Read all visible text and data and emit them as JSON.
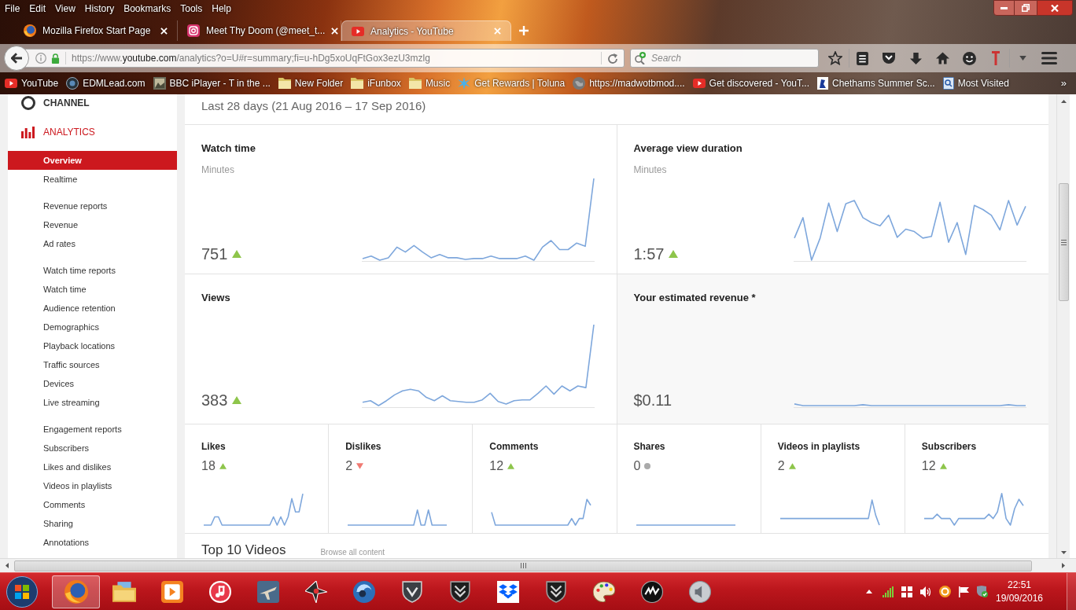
{
  "menu_bar": [
    "File",
    "Edit",
    "View",
    "History",
    "Bookmarks",
    "Tools",
    "Help"
  ],
  "tabs": [
    {
      "title": "Mozilla Firefox Start Page",
      "kind": "browser",
      "selected": false
    },
    {
      "title": "Meet Thy Doom (@meet_t...",
      "kind": "camera",
      "selected": false
    },
    {
      "title": "Analytics - YouTube",
      "kind": "video",
      "selected": true
    }
  ],
  "address_bar": {
    "url_prefix": "https://www.",
    "url_domain": "youtube.com",
    "url_path": "/analytics?o=U#r=summary;fi=u-hDg5xoUqFtGox3ezU3mzlg"
  },
  "search": {
    "placeholder": "Search"
  },
  "bookmarks": [
    {
      "label": "YouTube",
      "kind": "video"
    },
    {
      "label": "EDMLead.com",
      "kind": "orb"
    },
    {
      "label": "BBC iPlayer - T in the ...",
      "kind": "picture"
    },
    {
      "label": "New Folder",
      "kind": "folder"
    },
    {
      "label": "iFunbox",
      "kind": "folder"
    },
    {
      "label": "Music",
      "kind": "folder"
    },
    {
      "label": "Get Rewards | Toluna",
      "kind": "burst"
    },
    {
      "label": "https://madwotbmod....",
      "kind": "globe"
    },
    {
      "label": "Get discovered - YouT...",
      "kind": "video"
    },
    {
      "label": "Chethams Summer Sc...",
      "kind": "figure"
    },
    {
      "label": "Most Visited",
      "kind": "page"
    }
  ],
  "bookmarks_overflow": "»",
  "sidebar": {
    "channel": "CHANNEL",
    "section": "ANALYTICS",
    "groups": [
      {
        "items": [
          {
            "label": "Overview",
            "selected": true
          },
          {
            "label": "Realtime",
            "selected": false
          }
        ]
      },
      {
        "items": [
          {
            "label": "Revenue reports",
            "selected": false
          },
          {
            "label": "Revenue",
            "selected": false
          },
          {
            "label": "Ad rates",
            "selected": false
          }
        ]
      },
      {
        "items": [
          {
            "label": "Watch time reports",
            "selected": false
          },
          {
            "label": "Watch time",
            "selected": false
          },
          {
            "label": "Audience retention",
            "selected": false
          },
          {
            "label": "Demographics",
            "selected": false
          },
          {
            "label": "Playback locations",
            "selected": false
          },
          {
            "label": "Traffic sources",
            "selected": false
          },
          {
            "label": "Devices",
            "selected": false
          },
          {
            "label": "Live streaming",
            "selected": false
          }
        ]
      },
      {
        "items": [
          {
            "label": "Engagement reports",
            "selected": false
          },
          {
            "label": "Subscribers",
            "selected": false
          },
          {
            "label": "Likes and dislikes",
            "selected": false
          },
          {
            "label": "Videos in playlists",
            "selected": false
          },
          {
            "label": "Comments",
            "selected": false
          },
          {
            "label": "Sharing",
            "selected": false
          },
          {
            "label": "Annotations",
            "selected": false
          }
        ]
      }
    ]
  },
  "report": {
    "date_range": "Last 28 days (21 Aug 2016 – 17 Sep 2016)",
    "cards": [
      {
        "title": "Watch time",
        "subtitle": "Minutes",
        "value": "751",
        "kind": "rising"
      },
      {
        "title": "Average view duration",
        "subtitle": "Minutes",
        "value": "1:57",
        "kind": "rising"
      },
      {
        "title": "Views",
        "value": "383",
        "kind": "rising"
      },
      {
        "title": "Your estimated revenue *",
        "value": "$0.11",
        "kind": "estimate"
      }
    ],
    "small_cards": [
      {
        "title": "Likes",
        "value": "18",
        "kind": "rising"
      },
      {
        "title": "Dislikes",
        "value": "2",
        "kind": "falling"
      },
      {
        "title": "Comments",
        "value": "12",
        "kind": "rising"
      },
      {
        "title": "Shares",
        "value": "0",
        "kind": "steady"
      },
      {
        "title": "Videos in playlists",
        "value": "2",
        "kind": "rising"
      },
      {
        "title": "Subscribers",
        "value": "12",
        "kind": "rising"
      }
    ],
    "top_videos": {
      "title": "Top 10 Videos",
      "link": "Browse all content"
    }
  },
  "taskbar": {
    "apps": [
      {
        "kind": "browser",
        "selected": true
      },
      {
        "kind": "explorer",
        "selected": false
      },
      {
        "kind": "media",
        "selected": false
      },
      {
        "kind": "music",
        "selected": false
      },
      {
        "kind": "plane",
        "selected": false
      },
      {
        "kind": "jet",
        "selected": false
      },
      {
        "kind": "swirl",
        "selected": false
      },
      {
        "kind": "warship",
        "selected": false
      },
      {
        "kind": "tank",
        "selected": false
      },
      {
        "kind": "box",
        "selected": false
      },
      {
        "kind": "tank",
        "selected": false
      },
      {
        "kind": "palette",
        "selected": false
      },
      {
        "kind": "disc",
        "selected": false
      },
      {
        "kind": "speaker",
        "selected": false
      }
    ],
    "time": "22:51",
    "date": "19/09/2016"
  }
}
